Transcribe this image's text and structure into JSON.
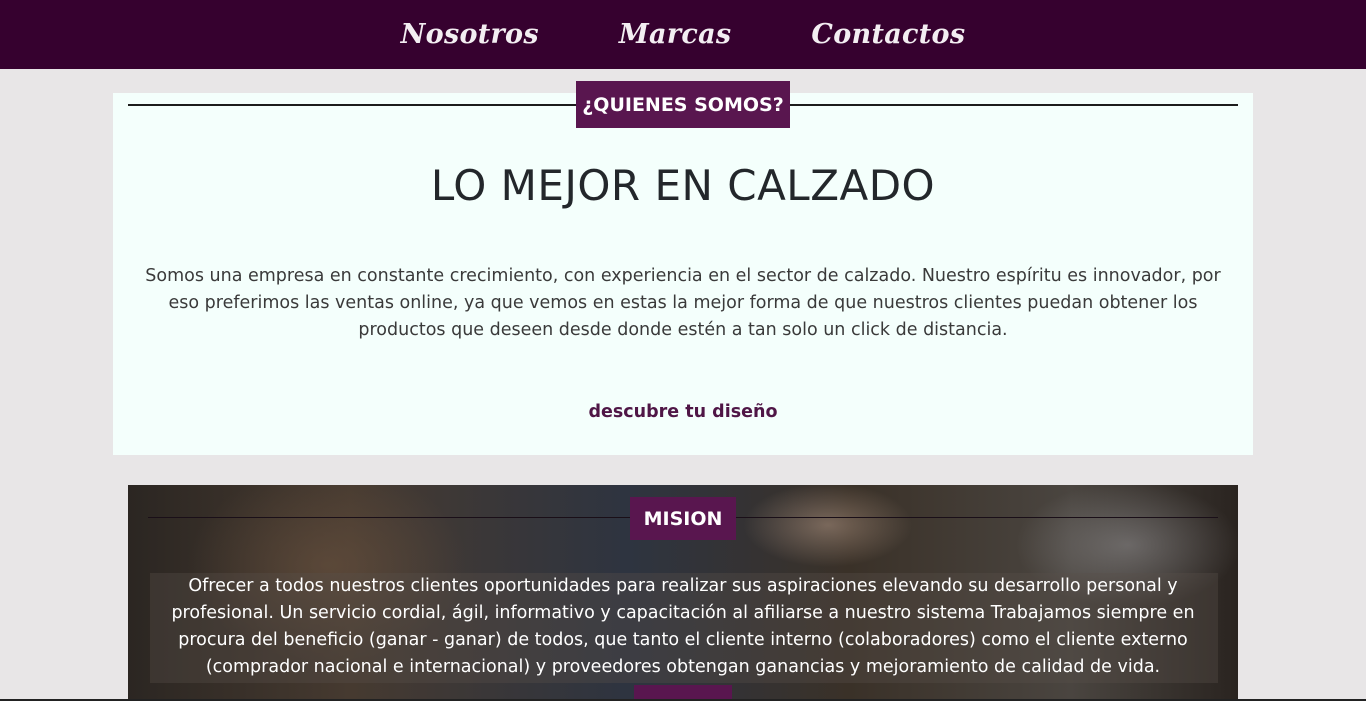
{
  "nav": {
    "items": [
      "Nosotros",
      "Marcas",
      "Contactos"
    ]
  },
  "about": {
    "badge": "¿QUIENES SOMOS?",
    "title": "LO MEJOR EN CALZADO",
    "text": "Somos una empresa en constante crecimiento, con experiencia en el sector de calzado. Nuestro espíritu es innovador, por eso preferimos las ventas online, ya que vemos en estas la mejor forma de que nuestros clientes puedan obtener los productos que deseen desde donde estén a tan solo un click de distancia.",
    "cta": "descubre tu diseño"
  },
  "mission": {
    "badge": "MISION",
    "text": "Ofrecer a todos nuestros clientes oportunidades para realizar sus aspiraciones elevando su desarrollo personal y profesional. Un servicio cordial, ágil, informativo y capacitación al afiliarse a nuestro sistema Trabajamos siempre en procura del beneficio (ganar - ganar) de todos, que tanto el cliente interno (colaboradores) como el cliente externo (comprador nacional e internacional) y proveedores obtengan ganancias y mejoramiento de calidad de vida."
  },
  "colors": {
    "nav_bg": "#36012f",
    "accent": "#59164f",
    "page_bg": "#e8e6e7",
    "card_bg": "#f4fffc"
  }
}
